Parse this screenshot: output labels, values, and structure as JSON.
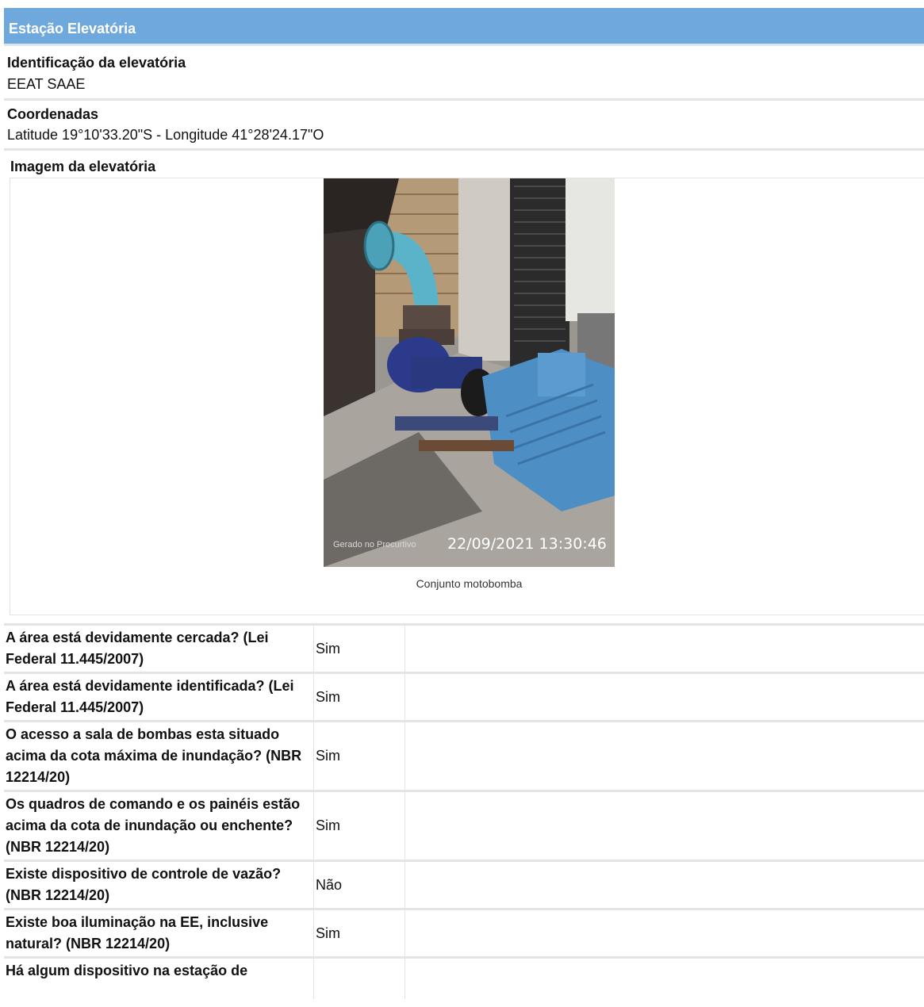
{
  "section": {
    "title": "Estação Elevatória"
  },
  "identificacao": {
    "label": "Identificação da elevatória",
    "value": "EEAT SAAE"
  },
  "coordenadas": {
    "label": "Coordenadas",
    "value": "Latitude 19°10'33.20\"S - Longitude 41°28'24.17\"O"
  },
  "imagem": {
    "label": "Imagem da elevatória",
    "watermark": "Gerado no Procurtivo",
    "timestamp": "22/09/2021 13:30:46",
    "caption": "Conjunto motobomba"
  },
  "questions": [
    {
      "text": "A área está devidamente cercada? (Lei Federal 11.445/2007)",
      "answer": "Sim"
    },
    {
      "text": "A área está devidamente identificada? (Lei Federal 11.445/2007)",
      "answer": "Sim"
    },
    {
      "text": "O acesso a sala de bombas esta situado acima da cota máxima de inundação? (NBR 12214/20)",
      "answer": "Sim"
    },
    {
      "text": "Os quadros de comando e os painéis estão acima da cota de inundação ou enchente? (NBR 12214/20)",
      "answer": "Sim"
    },
    {
      "text": "Existe dispositivo de controle de vazão? (NBR 12214/20)",
      "answer": "Não"
    },
    {
      "text": "Existe boa iluminação na EE, inclusive natural? (NBR 12214/20)",
      "answer": "Sim"
    },
    {
      "text": "Há algum dispositivo na estação de",
      "answer": ""
    }
  ]
}
